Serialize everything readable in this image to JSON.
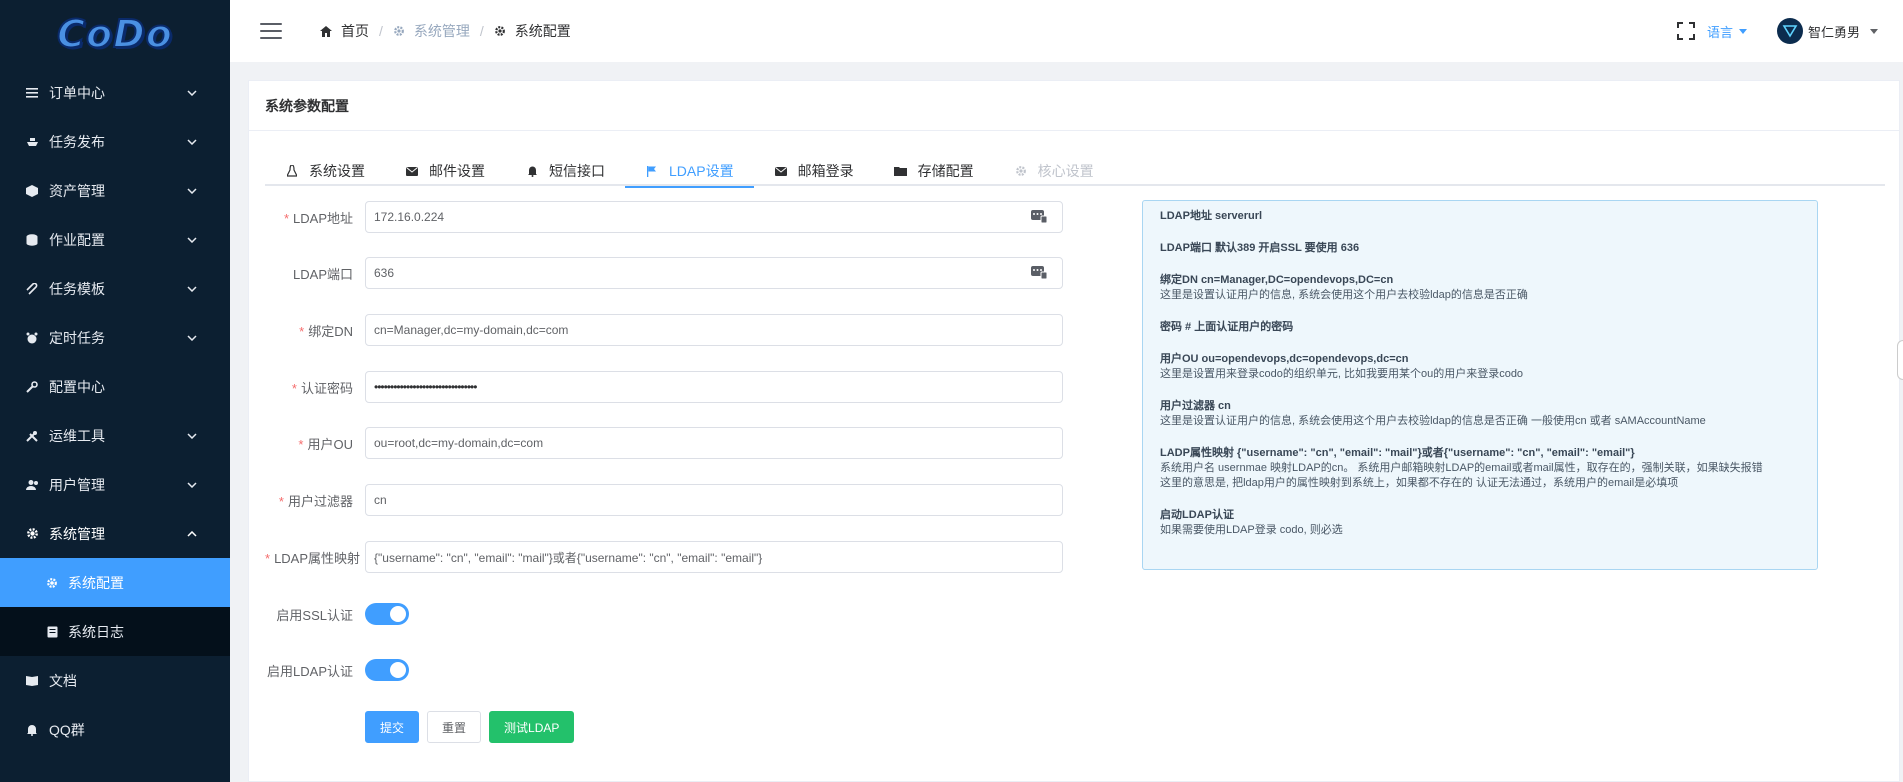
{
  "sidebar": {
    "logo": "CoDo",
    "menu": [
      {
        "label": "订单中心",
        "icon": "list-icon"
      },
      {
        "label": "任务发布",
        "icon": "ship-icon"
      },
      {
        "label": "资产管理",
        "icon": "cube-icon"
      },
      {
        "label": "作业配置",
        "icon": "database-icon"
      },
      {
        "label": "任务模板",
        "icon": "paperclip-icon"
      },
      {
        "label": "定时任务",
        "icon": "alarm-icon"
      },
      {
        "label": "配置中心",
        "icon": "wrench-icon"
      },
      {
        "label": "运维工具",
        "icon": "tools-icon"
      },
      {
        "label": "用户管理",
        "icon": "users-icon"
      },
      {
        "label": "系统管理",
        "icon": "gear-icon"
      }
    ],
    "submenu": [
      {
        "label": "系统配置",
        "icon": "gear-icon",
        "active": true
      },
      {
        "label": "系统日志",
        "icon": "log-icon",
        "active": false
      }
    ],
    "bottom": [
      {
        "label": "文档",
        "icon": "book-icon"
      },
      {
        "label": "QQ群",
        "icon": "bell-icon"
      }
    ]
  },
  "header": {
    "breadcrumb": [
      "首页",
      "系统管理",
      "系统配置"
    ],
    "language": "语言",
    "username": "智仁勇男"
  },
  "card": {
    "title": "系统参数配置",
    "tabs": [
      {
        "label": "系统设置",
        "icon": "linux-icon",
        "state": "normal"
      },
      {
        "label": "邮件设置",
        "icon": "envelope-icon",
        "state": "normal"
      },
      {
        "label": "短信接口",
        "icon": "bell-icon",
        "state": "normal"
      },
      {
        "label": "LDAP设置",
        "icon": "flag-icon",
        "state": "active"
      },
      {
        "label": "邮箱登录",
        "icon": "envelope-icon",
        "state": "normal"
      },
      {
        "label": "存储配置",
        "icon": "folder-icon",
        "state": "normal"
      },
      {
        "label": "核心设置",
        "icon": "gear-icon",
        "state": "disabled"
      }
    ]
  },
  "form": {
    "fields": [
      {
        "label": "LDAP地址",
        "required": true,
        "value": "172.16.0.224",
        "suffix": true
      },
      {
        "label": "LDAP端口",
        "required": false,
        "value": "636",
        "suffix": true
      },
      {
        "label": "绑定DN",
        "required": true,
        "value": "cn=Manager,dc=my-domain,dc=com",
        "suffix": false
      },
      {
        "label": "认证密码",
        "required": true,
        "value": "••••••••••••••••••••••••••••••••",
        "suffix": false
      },
      {
        "label": "用户OU",
        "required": true,
        "value": "ou=root,dc=my-domain,dc=com",
        "suffix": false
      },
      {
        "label": "用户过滤器",
        "required": true,
        "value": "cn",
        "suffix": false
      },
      {
        "label": "LDAP属性映射",
        "required": true,
        "value": "{\"username\": \"cn\", \"email\": \"mail\"}或者{\"username\": \"cn\", \"email\": \"email\"}",
        "suffix": false
      }
    ],
    "switches": [
      {
        "label": "启用SSL认证",
        "on": true
      },
      {
        "label": "启用LDAP认证",
        "on": true
      }
    ],
    "buttons": {
      "submit": "提交",
      "reset": "重置",
      "test": "测试LDAP"
    }
  },
  "help": [
    {
      "title": "LDAP地址 serverurl",
      "lines": []
    },
    {
      "title": "LDAP端口 默认389 开启SSL 要使用 636",
      "lines": []
    },
    {
      "title": "绑定DN cn=Manager,DC=opendevops,DC=cn",
      "lines": [
        "这里是设置认证用户的信息, 系统会使用这个用户去校验ldap的信息是否正确"
      ]
    },
    {
      "title": "密码 # 上面认证用户的密码",
      "lines": []
    },
    {
      "title": "用户OU ou=opendevops,dc=opendevops,dc=cn",
      "lines": [
        "这里是设置用来登录codo的组织单元, 比如我要用某个ou的用户来登录codo"
      ]
    },
    {
      "title": "用户过滤器 cn",
      "lines": [
        "这里是设置认证用户的信息, 系统会使用这个用户去校验ldap的信息是否正确 一般使用cn 或者 sAMAccountName"
      ]
    },
    {
      "title": "LADP属性映射 {\"username\": \"cn\", \"email\": \"mail\"}或者{\"username\": \"cn\", \"email\": \"email\"}",
      "lines": [
        "系统用户名 usernmae 映射LDAP的cn。 系统用户邮箱映射LDAP的email或者mail属性，取存在的，强制关联，如果缺失报错",
        "这里的意思是, 把ldap用户的属性映射到系统上，如果都不存在的 认证无法通过，系统用户的email是必填项"
      ]
    },
    {
      "title": "启动LDAP认证",
      "lines": [
        "如果需要使用LDAP登录 codo, 则必选"
      ]
    }
  ]
}
